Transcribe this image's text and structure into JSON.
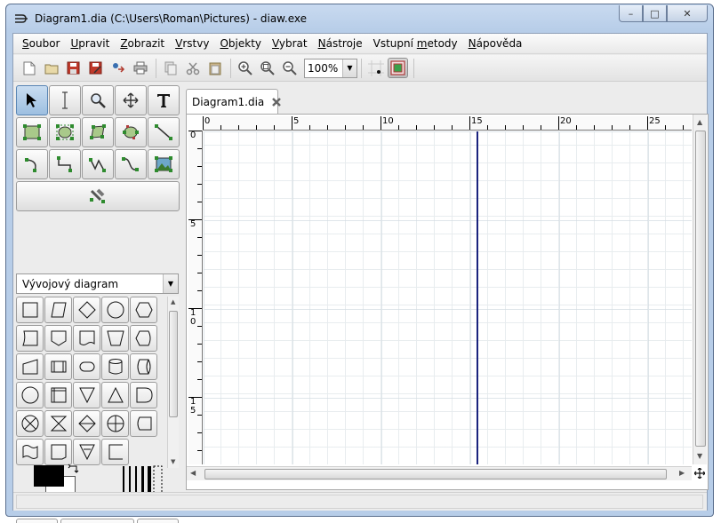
{
  "window": {
    "title": "Diagram1.dia (C:\\Users\\Roman\\Pictures) - diaw.exe",
    "minimize": "–",
    "maximize": "□",
    "close": "✕"
  },
  "menu": [
    {
      "pre": "",
      "key": "S",
      "post": "oubor"
    },
    {
      "pre": "",
      "key": "U",
      "post": "pravit"
    },
    {
      "pre": "",
      "key": "Z",
      "post": "obrazit"
    },
    {
      "pre": "",
      "key": "V",
      "post": "rstvy"
    },
    {
      "pre": "",
      "key": "O",
      "post": "bjekty"
    },
    {
      "pre": "",
      "key": "V",
      "post": "ybrat"
    },
    {
      "pre": "",
      "key": "N",
      "post": "ástroje"
    },
    {
      "pre": "Vstupní ",
      "key": "m",
      "post": "etody"
    },
    {
      "pre": "",
      "key": "N",
      "post": "ápověda"
    }
  ],
  "toolbar": {
    "icons": [
      "new-file-icon",
      "open-folder-icon",
      "save-icon",
      "save-as-icon",
      "export-icon",
      "print-icon",
      "copy-icon",
      "cut-icon",
      "paste-icon",
      "zoom-in-icon",
      "zoom-fit-icon",
      "zoom-out-icon",
      "snap-to-grid-icon",
      "object-snap-icon"
    ],
    "zoom_value": "100%"
  },
  "tools": [
    "pointer-tool",
    "text-edit-tool",
    "magnify-tool",
    "scroll-tool",
    "text-tool",
    "box-tool",
    "ellipse-tool",
    "polygon-tool",
    "beziergon-tool",
    "line-tool",
    "arc-tool",
    "zigzag-line-tool",
    "polyline-tool",
    "bezier-line-tool",
    "image-tool",
    "outline-tool"
  ],
  "sheet": {
    "selected": "Vývojový diagram"
  },
  "shapes": [
    "process",
    "input-output",
    "decision",
    "connector",
    "preparation",
    "punched-card",
    "off-page-connector",
    "document",
    "manual-operation",
    "display",
    "manual-input",
    "predefined-process",
    "terminal",
    "magnetic-disk",
    "direct-access-storage",
    "start-end",
    "internal-storage",
    "extract",
    "merge",
    "delay",
    "summing-junction",
    "collate",
    "sort",
    "or",
    "stored-data",
    "punched-tape",
    "transfer",
    "offline-storage",
    "annotation"
  ],
  "tab": {
    "label": "Diagram1.dia"
  },
  "ruler": {
    "h_labels": [
      "0",
      "5",
      "10",
      "15",
      "20",
      "25"
    ],
    "v_labels": [
      "0",
      "5",
      "1\n0",
      "1\n5"
    ]
  },
  "colors": {
    "accent": "#1a237e",
    "foreground": "#000000",
    "background": "#ffffff"
  }
}
